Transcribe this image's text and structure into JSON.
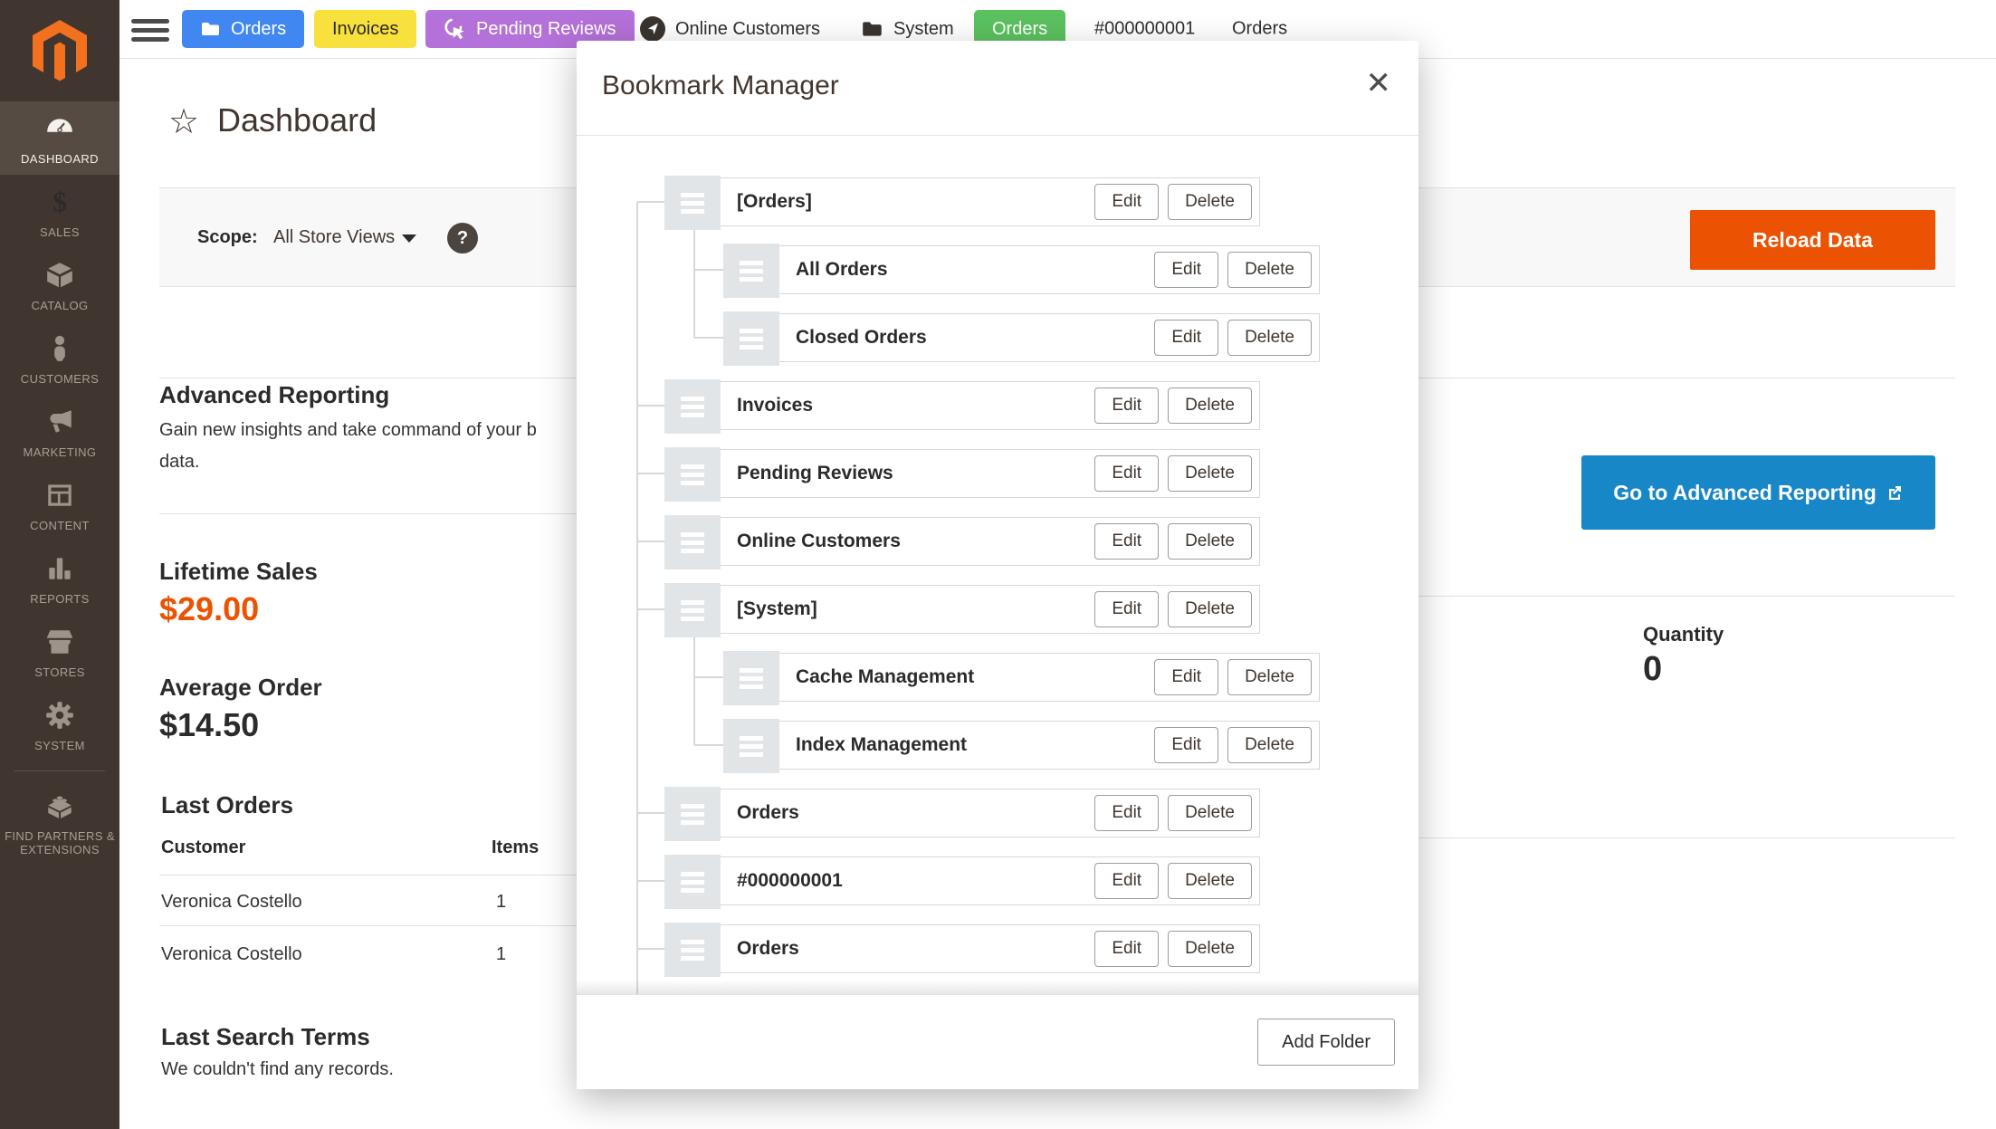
{
  "topbar": {
    "items": [
      {
        "label": "Orders",
        "style": "chip-blue",
        "icon": "folder-icon"
      },
      {
        "label": "Invoices",
        "style": "chip-yellow",
        "icon": null
      },
      {
        "label": "Pending Reviews",
        "style": "chip-purple",
        "icon": "pending-review-icon"
      },
      {
        "label": "Online Customers",
        "style": "text",
        "icon": "online-customers-icon"
      },
      {
        "label": "System",
        "style": "text",
        "icon": "dark-folder-icon"
      },
      {
        "label": "Orders",
        "style": "chip-green",
        "icon": null
      },
      {
        "label": "#000000001",
        "style": "text",
        "icon": null
      },
      {
        "label": "Orders",
        "style": "text",
        "icon": null
      }
    ]
  },
  "sidebar": {
    "items": [
      {
        "label": "DASHBOARD",
        "icon": "dashboard-icon",
        "active": true
      },
      {
        "label": "SALES",
        "icon": "sales-icon"
      },
      {
        "label": "CATALOG",
        "icon": "catalog-icon"
      },
      {
        "label": "CUSTOMERS",
        "icon": "customers-icon"
      },
      {
        "label": "MARKETING",
        "icon": "marketing-icon"
      },
      {
        "label": "CONTENT",
        "icon": "content-icon"
      },
      {
        "label": "REPORTS",
        "icon": "reports-icon"
      },
      {
        "label": "STORES",
        "icon": "stores-icon"
      },
      {
        "label": "SYSTEM",
        "icon": "system-icon"
      },
      {
        "label": "FIND PARTNERS & EXTENSIONS",
        "icon": "extensions-icon",
        "divider_above": true
      }
    ]
  },
  "page": {
    "title": "Dashboard",
    "scope": {
      "label": "Scope:",
      "value": "All Store Views"
    },
    "reload_button": "Reload Data",
    "advanced_reporting": {
      "heading": "Advanced Reporting",
      "line1": "Gain new insights and take command of your b",
      "line2": "data."
    },
    "lifetime_sales": {
      "label": "Lifetime Sales",
      "value": "$29.00"
    },
    "average_order": {
      "label": "Average Order",
      "value": "$14.50"
    },
    "go_advanced_button": "Go to Advanced Reporting",
    "quantity": {
      "label": "Quantity",
      "value": "0"
    },
    "last_orders": {
      "heading": "Last Orders",
      "columns": [
        "Customer",
        "Items"
      ],
      "rows": [
        {
          "customer": "Veronica Costello",
          "items": "1"
        },
        {
          "customer": "Veronica Costello",
          "items": "1"
        }
      ]
    },
    "last_search": {
      "heading": "Last Search Terms",
      "empty_message": "We couldn't find any records."
    }
  },
  "modal": {
    "title": "Bookmark Manager",
    "action_edit": "Edit",
    "action_delete": "Delete",
    "add_folder_button": "Add Folder",
    "rows": [
      {
        "label": "[Orders]",
        "level": 0
      },
      {
        "label": "All Orders",
        "level": 1
      },
      {
        "label": "Closed Orders",
        "level": 1
      },
      {
        "label": "Invoices",
        "level": 0
      },
      {
        "label": "Pending Reviews",
        "level": 0
      },
      {
        "label": "Online Customers",
        "level": 0
      },
      {
        "label": "[System]",
        "level": 0
      },
      {
        "label": "Cache Management",
        "level": 1
      },
      {
        "label": "Index Management",
        "level": 1
      },
      {
        "label": "Orders",
        "level": 0
      },
      {
        "label": "#000000001",
        "level": 0
      },
      {
        "label": "Orders",
        "level": 0
      },
      {
        "label": "",
        "level": 0,
        "partial": true
      }
    ]
  },
  "colors": {
    "accent_orange": "#eb5202",
    "primary_blue": "#1787c8",
    "chip_blue": "#4187f2",
    "chip_yellow": "#f9e13d",
    "chip_purple": "#b471d9",
    "chip_green": "#5bc15f",
    "sidebar_bg": "#41362f"
  }
}
